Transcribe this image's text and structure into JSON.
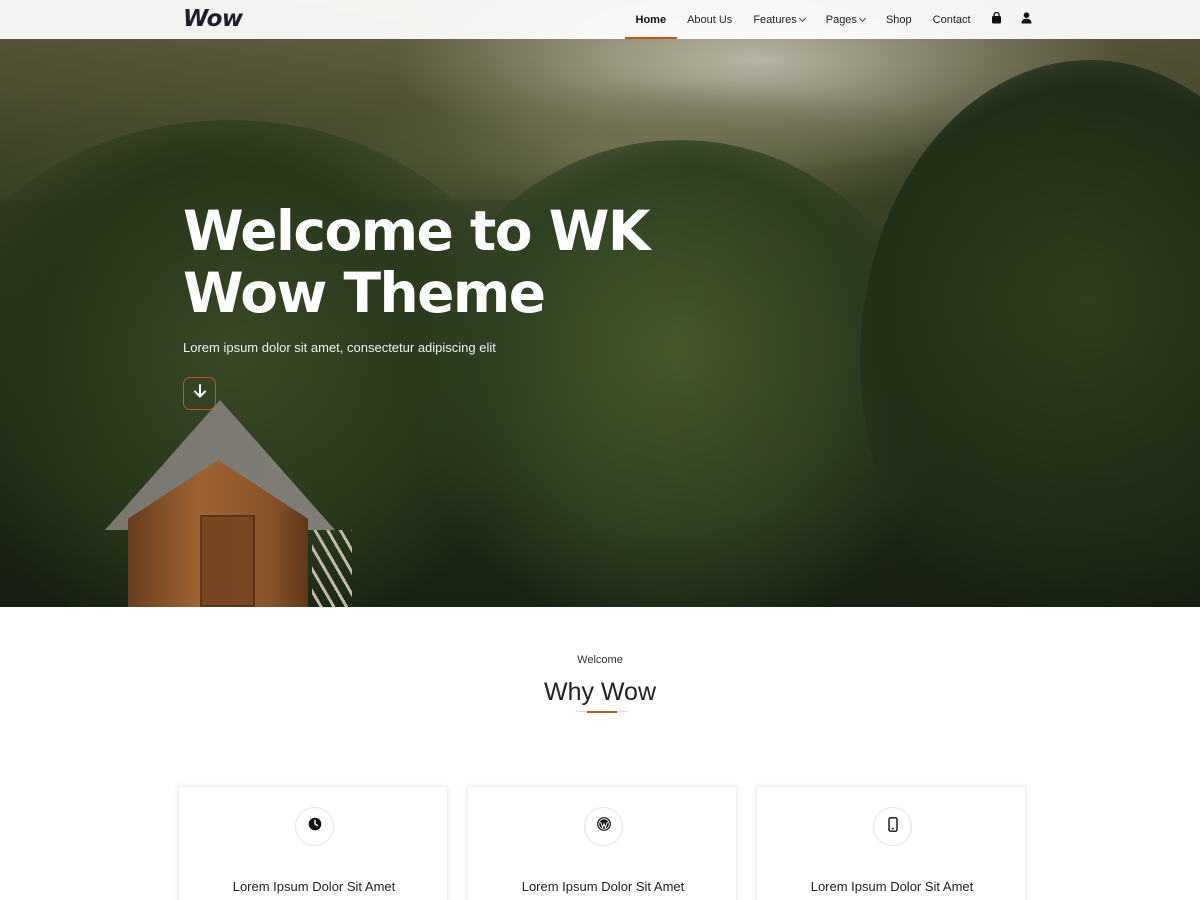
{
  "header": {
    "logo": "Wow",
    "menu": [
      {
        "label": "Home",
        "active": true,
        "dropdown": false
      },
      {
        "label": "About Us",
        "active": false,
        "dropdown": false
      },
      {
        "label": "Features",
        "active": false,
        "dropdown": true
      },
      {
        "label": "Pages",
        "active": false,
        "dropdown": true
      },
      {
        "label": "Shop",
        "active": false,
        "dropdown": false
      },
      {
        "label": "Contact",
        "active": false,
        "dropdown": false
      }
    ],
    "icons": [
      "shopping-bag-icon",
      "user-icon"
    ]
  },
  "hero": {
    "title_line1": "Welcome to WK",
    "title_line2": "Wow Theme",
    "subtitle": "Lorem ipsum dolor sit amet, consectetur adipiscing elit",
    "scroll_icon": "arrow-down-icon"
  },
  "welcome_section": {
    "eyebrow": "Welcome",
    "title": "Why Wow",
    "cards": [
      {
        "icon": "clock-icon",
        "title": "Lorem Ipsum Dolor Sit Amet"
      },
      {
        "icon": "wordpress-icon",
        "title": "Lorem Ipsum Dolor Sit Amet"
      },
      {
        "icon": "mobile-phone-icon",
        "title": "Lorem Ipsum Dolor Sit Amet"
      }
    ]
  },
  "colors": {
    "accent": "#c0571e",
    "text_dark": "#222222",
    "logo": "#1d1f2a"
  }
}
